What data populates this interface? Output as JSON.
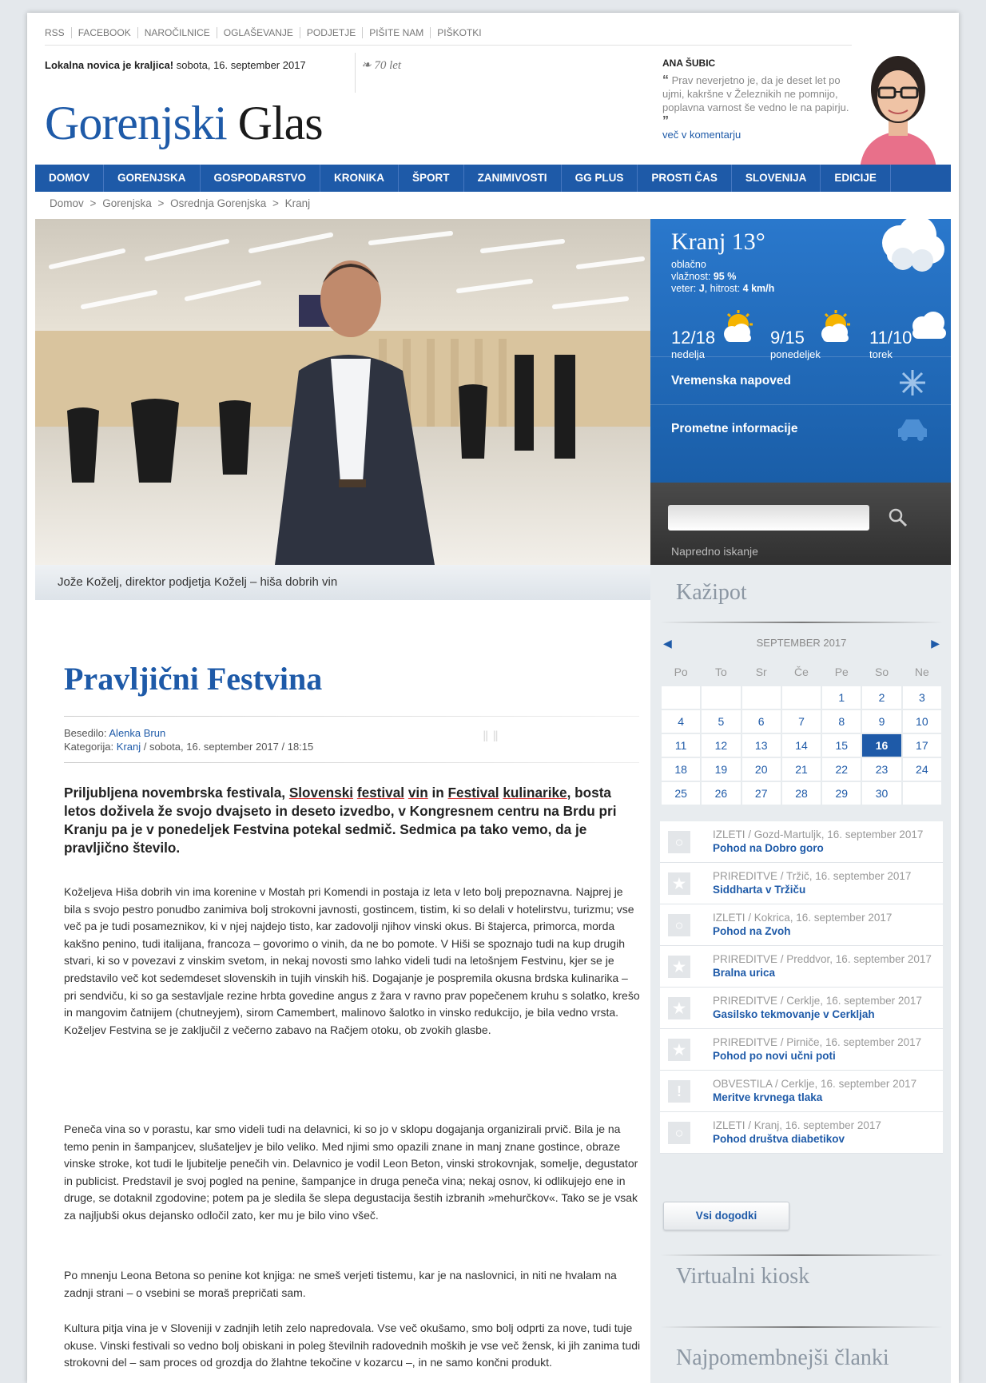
{
  "toplinks": [
    "RSS",
    "FACEBOOK",
    "NAROČILNICE",
    "OGLAŠEVANJE",
    "PODJETJE",
    "PIŠITE NAM",
    "PIŠKOTKI"
  ],
  "header": {
    "slogan": "Lokalna novica je kraljica!",
    "date": "sobota, 16. september 2017",
    "anniversary": "70 let",
    "logo_part1": "Gorenjski",
    "logo_part2": "Glas"
  },
  "comment": {
    "author": "ANA ŠUBIC",
    "quote": "Prav neverjetno je, da je deset let po ujmi, kakršne v Železnikih ne pomnijo, poplavna varnost še vedno le na papirju.",
    "more": "več v komentarju"
  },
  "nav": [
    "DOMOV",
    "GORENJSKA",
    "GOSPODARSTVO",
    "KRONIKA",
    "ŠPORT",
    "ZANIMIVOSTI",
    "GG PLUS",
    "PROSTI ČAS",
    "SLOVENIJA",
    "EDICIJE"
  ],
  "breadcrumb": [
    "Domov",
    ">",
    "Gorenjska",
    ">",
    "Osrednja Gorenjska",
    ">",
    "Kranj"
  ],
  "hero": {
    "caption": "Jože Koželj, direktor podjetja Koželj – hiša dobrih vin"
  },
  "weather": {
    "city": "Kranj 13°",
    "condition": "oblačno",
    "humidity_label": "vlažnost:",
    "humidity": "95 %",
    "wind_label": "veter:",
    "wind_dir": "J",
    "speed_label": ", hitrost:",
    "speed": "4 km/h",
    "days": [
      {
        "temp": "12/18",
        "name": "nedelja",
        "icon": "sun-cloud-icon"
      },
      {
        "temp": "9/15",
        "name": "ponedeljek",
        "icon": "sun-cloud-icon"
      },
      {
        "temp": "11/10",
        "name": "torek",
        "icon": "cloud-icon"
      }
    ],
    "forecast_link": "Vremenska napoved",
    "traffic_link": "Prometne informacije"
  },
  "search": {
    "advanced": "Napredno iskanje"
  },
  "kazipot": {
    "title": "Kažipot",
    "month": "SEPTEMBER 2017",
    "weekdays": [
      "Po",
      "To",
      "Sr",
      "Če",
      "Pe",
      "So",
      "Ne"
    ],
    "weeks": [
      [
        "",
        "",
        "",
        "",
        "1",
        "2",
        "3"
      ],
      [
        "4",
        "5",
        "6",
        "7",
        "8",
        "9",
        "10"
      ],
      [
        "11",
        "12",
        "13",
        "14",
        "15",
        "16",
        "17"
      ],
      [
        "18",
        "19",
        "20",
        "21",
        "22",
        "23",
        "24"
      ],
      [
        "25",
        "26",
        "27",
        "28",
        "29",
        "30",
        ""
      ]
    ],
    "today": "16",
    "events": [
      {
        "meta": "IZLETI / Gozd-Martuljk, 16. september 2017",
        "title": "Pohod na Dobro goro",
        "icon": "circle-icon"
      },
      {
        "meta": "PRIREDITVE / Tržič, 16. september 2017",
        "title": "Siddharta v Tržiču",
        "icon": "star-icon"
      },
      {
        "meta": "IZLETI / Kokrica, 16. september 2017",
        "title": "Pohod na Zvoh",
        "icon": "circle-icon"
      },
      {
        "meta": "PRIREDITVE / Preddvor, 16. september 2017",
        "title": "Bralna urica",
        "icon": "star-icon"
      },
      {
        "meta": "PRIREDITVE / Cerklje, 16. september 2017",
        "title": "Gasilsko tekmovanje v Cerkljah",
        "icon": "star-icon"
      },
      {
        "meta": "PRIREDITVE / Pirniče, 16. september 2017",
        "title": "Pohod po novi učni poti",
        "icon": "star-icon"
      },
      {
        "meta": "OBVESTILA / Cerklje, 16. september 2017",
        "title": "Meritve krvnega tlaka",
        "icon": "exclamation-icon"
      },
      {
        "meta": "IZLETI / Kranj, 16. september 2017",
        "title": "Pohod društva diabetikov",
        "icon": "circle-icon"
      }
    ],
    "all_events": "Vsi dogodki"
  },
  "sidebar": {
    "kiosk_title": "Virtualni kiosk",
    "top_title": "Najpomembnejši članki"
  },
  "article": {
    "title": "Pravljični Festvina",
    "author_label": "Besedilo:",
    "author": "Alenka Brun",
    "category_label": "Kategorija:",
    "category": "Kranj",
    "datetime": "/ sobota, 16. september 2017 / 18:15",
    "lead_1": "Priljubljena novembrska festivala,",
    "lead_u1": "Slovenski",
    "lead_u2": "festival",
    "lead_u3": "vin",
    "lead_2": "in",
    "lead_u4": "Festival",
    "lead_u5": "kulinarike",
    "lead_3": ", bosta letos doživela že svojo dvajseto in deseto izvedbo, v Kongresnem centru na Brdu pri Kranju pa je v ponedeljek Festvina potekal sedmič. Sedmica pa tako vemo, da je pravljično število.",
    "p1": "Koželjeva Hiša dobrih vin ima korenine v Mostah pri Komendi in postaja iz leta v leto bolj prepoznavna. Najprej je bila s svojo pestro ponudbo zanimiva bolj strokovni javnosti, gostincem, tistim, ki so delali v hotelirstvu, turizmu; vse več pa je tudi posameznikov, ki v njej najdejo tisto, kar zadovolji njihov vinski okus. Bi štajerca, primorca, morda kakšno penino, tudi italijana, francoza – govorimo o vinih, da ne bo pomote. V Hiši se spoznajo tudi na kup drugih stvari, ki so v povezavi z vinskim svetom, in nekaj novosti smo lahko videli tudi na letošnjem Festvinu, kjer se je predstavilo več kot sedemdeset slovenskih in tujih vinskih hiš. Dogajanje je pospremila okusna brdska kulinarika – pri sendviču, ki so ga sestavljale rezine hrbta govedine angus z žara v ravno prav popečenem kruhu s solatko, krešo in mangovim čatnijem (chutneyjem), sirom Camembert, malinovo šalotko in vinsko redukcijo, je bila vedno vrsta. Koželjev Festvina se je zaključil z večerno zabavo na Račjem otoku, ob zvokih glasbe.",
    "p2": "Peneča vina so v porastu, kar smo videli tudi na delavnici, ki so jo v sklopu dogajanja organizirali prvič. Bila je na temo penin in šampanjcev, slušateljev je bilo veliko. Med njimi smo opazili znane in manj znane gostince, obraze vinske stroke, kot tudi le ljubitelje penečih vin. Delavnico je vodil Leon Beton, vinski strokovnjak, somelje, degustator in publicist. Predstavil je svoj pogled na penine, šampanjce in druga peneča vina; nekaj osnov, ki odlikujejo ene in druge, se dotaknil zgodovine; potem pa je sledila še slepa degustacija šestih izbranih »mehurčkov«. Tako se je vsak za najljubši okus dejansko odločil zato, ker mu je bilo vino všeč.",
    "p3": "Po mnenju Leona Betona so penine kot knjiga: ne smeš verjeti tistemu, kar je na naslovnici, in niti ne hvalam na zadnji strani – o vsebini se moraš prepričati sam.",
    "p4": "Kultura pitja vina je v Sloveniji v zadnjih letih zelo napredovala. Vse več okušamo, smo bolj odprti za nove, tudi tuje okuse. Vinski festivali so vedno bolj obiskani in poleg številnih radovednih moških je vse več žensk, ki jih zanima tudi strokovni del – sam proces od grozdja do žlahtne tekočine v kozarcu –, in ne samo končni produkt."
  },
  "colors": {
    "brand_blue": "#1e5aa8",
    "weather_blue": "#2a78cc",
    "sidebar_bg": "#e8ecef"
  }
}
